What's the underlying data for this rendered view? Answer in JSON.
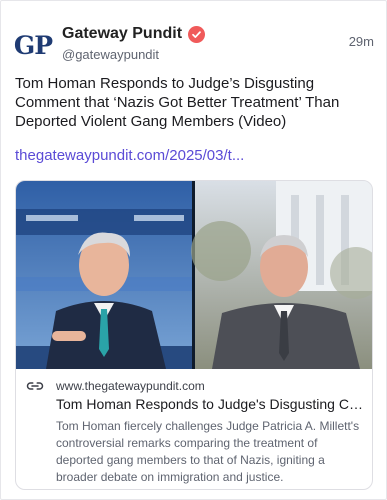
{
  "post": {
    "author": {
      "display_name": "Gateway Pundit",
      "handle": "@gatewaypundit",
      "avatar_text": "GP",
      "verified": true
    },
    "time": "29m",
    "text": "Tom Homan Responds to Judge’s Disgusting Comment that ‘Nazis Got Better Treatment’ Than Deported Violent Gang Members (Video)",
    "link_text": "thegatewaypundit.com/2025/03/t..."
  },
  "card": {
    "domain": "www.thegatewaypundit.com",
    "title": "Tom Homan Responds to Judge's Disgusting Comment that ‘Nazis Got Better Treatment’ Than Deported Violent Gang Members (Video)",
    "description": "Tom Homan fiercely challenges Judge Patricia A. Millett's controversial remarks comparing the treatment of deported gang members to that of Nazis, igniting a broader debate on immigration and justice.",
    "image_alt": "Split-screen of two men in suits being interviewed"
  },
  "colors": {
    "link": "#5b4bd6",
    "verified_badge": "#f05a5a",
    "logo_blue": "#1f3b73"
  },
  "icons": [
    "verified-badge-icon",
    "link-icon"
  ]
}
